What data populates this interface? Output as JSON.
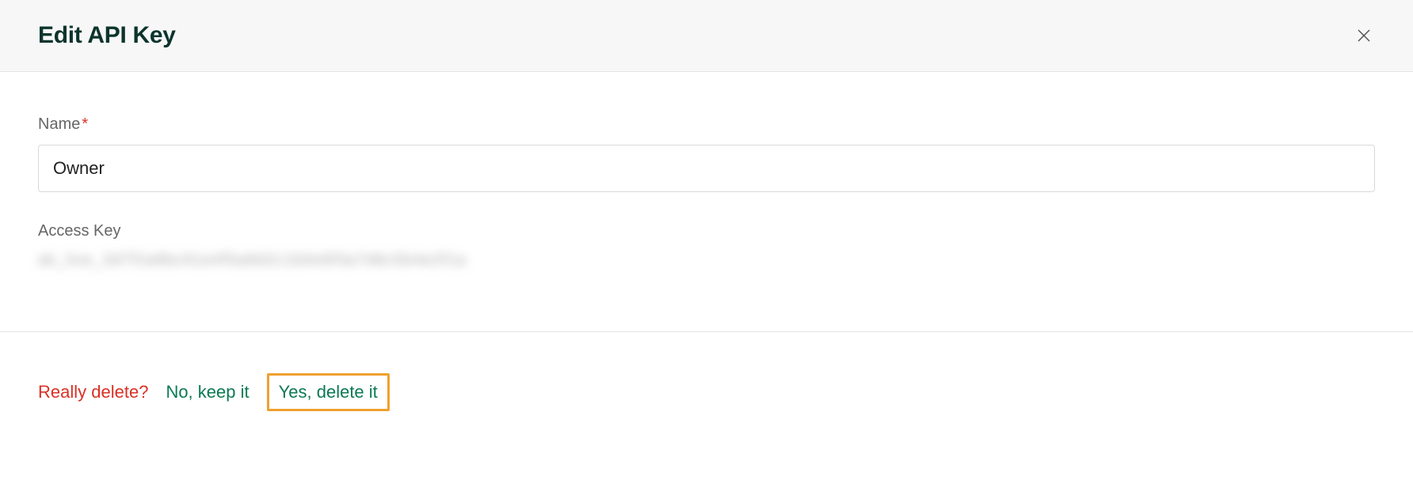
{
  "header": {
    "title": "Edit API Key"
  },
  "form": {
    "name_label": "Name",
    "name_value": "Owner",
    "access_key_label": "Access Key",
    "access_key_value": "ak_live_3d7f2a8bc91e4f5a8d2c1b0e9f3a7d6c5b4e2f1a"
  },
  "footer": {
    "confirm_question": "Really delete?",
    "keep_label": "No, keep it",
    "delete_label": "Yes, delete it"
  }
}
